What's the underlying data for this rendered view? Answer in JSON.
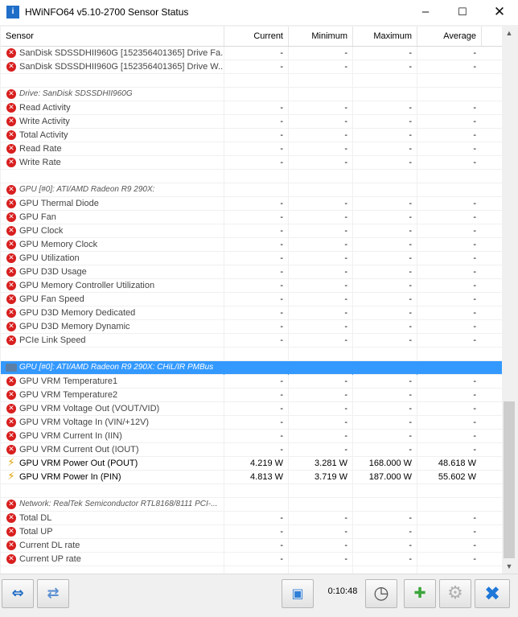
{
  "window": {
    "title": "HWiNFO64 v5.10-2700 Sensor Status",
    "icon_text": "i"
  },
  "columns": {
    "sensor": "Sensor",
    "current": "Current",
    "minimum": "Minimum",
    "maximum": "Maximum",
    "average": "Average"
  },
  "rows": [
    {
      "type": "item",
      "icon": "error",
      "label": "SanDisk SDSSDHII960G [152356401365] Drive Fa...",
      "current": "-",
      "min": "-",
      "max": "-",
      "avg": "-"
    },
    {
      "type": "item",
      "icon": "error",
      "label": "SanDisk SDSSDHII960G [152356401365] Drive W...",
      "current": "-",
      "min": "-",
      "max": "-",
      "avg": "-"
    },
    {
      "type": "blank"
    },
    {
      "type": "group",
      "icon": "error",
      "label": "Drive: SanDisk SDSSDHII960G"
    },
    {
      "type": "item",
      "icon": "error",
      "label": "Read Activity",
      "current": "-",
      "min": "-",
      "max": "-",
      "avg": "-"
    },
    {
      "type": "item",
      "icon": "error",
      "label": "Write Activity",
      "current": "-",
      "min": "-",
      "max": "-",
      "avg": "-"
    },
    {
      "type": "item",
      "icon": "error",
      "label": "Total Activity",
      "current": "-",
      "min": "-",
      "max": "-",
      "avg": "-"
    },
    {
      "type": "item",
      "icon": "error",
      "label": "Read Rate",
      "current": "-",
      "min": "-",
      "max": "-",
      "avg": "-"
    },
    {
      "type": "item",
      "icon": "error",
      "label": "Write Rate",
      "current": "-",
      "min": "-",
      "max": "-",
      "avg": "-"
    },
    {
      "type": "blank"
    },
    {
      "type": "group",
      "icon": "error",
      "label": "GPU [#0]: ATI/AMD Radeon R9 290X:"
    },
    {
      "type": "item",
      "icon": "error",
      "label": "GPU Thermal Diode",
      "current": "-",
      "min": "-",
      "max": "-",
      "avg": "-"
    },
    {
      "type": "item",
      "icon": "error",
      "label": "GPU Fan",
      "current": "-",
      "min": "-",
      "max": "-",
      "avg": "-"
    },
    {
      "type": "item",
      "icon": "error",
      "label": "GPU Clock",
      "current": "-",
      "min": "-",
      "max": "-",
      "avg": "-"
    },
    {
      "type": "item",
      "icon": "error",
      "label": "GPU Memory Clock",
      "current": "-",
      "min": "-",
      "max": "-",
      "avg": "-"
    },
    {
      "type": "item",
      "icon": "error",
      "label": "GPU Utilization",
      "current": "-",
      "min": "-",
      "max": "-",
      "avg": "-"
    },
    {
      "type": "item",
      "icon": "error",
      "label": "GPU D3D Usage",
      "current": "-",
      "min": "-",
      "max": "-",
      "avg": "-"
    },
    {
      "type": "item",
      "icon": "error",
      "label": "GPU Memory Controller Utilization",
      "current": "-",
      "min": "-",
      "max": "-",
      "avg": "-"
    },
    {
      "type": "item",
      "icon": "error",
      "label": "GPU Fan Speed",
      "current": "-",
      "min": "-",
      "max": "-",
      "avg": "-"
    },
    {
      "type": "item",
      "icon": "error",
      "label": "GPU D3D Memory Dedicated",
      "current": "-",
      "min": "-",
      "max": "-",
      "avg": "-"
    },
    {
      "type": "item",
      "icon": "error",
      "label": "GPU D3D Memory Dynamic",
      "current": "-",
      "min": "-",
      "max": "-",
      "avg": "-"
    },
    {
      "type": "item",
      "icon": "error",
      "label": "PCIe Link Speed",
      "current": "-",
      "min": "-",
      "max": "-",
      "avg": "-"
    },
    {
      "type": "blank"
    },
    {
      "type": "group",
      "icon": "gpu",
      "selected": true,
      "label": "GPU [#0]: ATI/AMD Radeon R9 290X: CHiL/IR PMBus"
    },
    {
      "type": "item",
      "icon": "error",
      "label": "GPU VRM Temperature1",
      "current": "-",
      "min": "-",
      "max": "-",
      "avg": "-"
    },
    {
      "type": "item",
      "icon": "error",
      "label": "GPU VRM Temperature2",
      "current": "-",
      "min": "-",
      "max": "-",
      "avg": "-"
    },
    {
      "type": "item",
      "icon": "error",
      "label": "GPU VRM Voltage Out (VOUT/VID)",
      "current": "-",
      "min": "-",
      "max": "-",
      "avg": "-"
    },
    {
      "type": "item",
      "icon": "error",
      "label": "GPU VRM Voltage In (VIN/+12V)",
      "current": "-",
      "min": "-",
      "max": "-",
      "avg": "-"
    },
    {
      "type": "item",
      "icon": "error",
      "label": "GPU VRM Current In (IIN)",
      "current": "-",
      "min": "-",
      "max": "-",
      "avg": "-"
    },
    {
      "type": "item",
      "icon": "error",
      "label": "GPU VRM Current Out (IOUT)",
      "current": "-",
      "min": "-",
      "max": "-",
      "avg": "-"
    },
    {
      "type": "item",
      "icon": "bolt",
      "label": "GPU VRM Power Out (POUT)",
      "current": "4.219 W",
      "min": "3.281 W",
      "max": "168.000 W",
      "avg": "48.618 W"
    },
    {
      "type": "item",
      "icon": "bolt",
      "label": "GPU VRM Power In (PIN)",
      "current": "4.813 W",
      "min": "3.719 W",
      "max": "187.000 W",
      "avg": "55.602 W"
    },
    {
      "type": "blank"
    },
    {
      "type": "group",
      "icon": "error",
      "label": "Network: RealTek Semiconductor RTL8168/8111 PCI-..."
    },
    {
      "type": "item",
      "icon": "error",
      "label": "Total DL",
      "current": "-",
      "min": "-",
      "max": "-",
      "avg": "-"
    },
    {
      "type": "item",
      "icon": "error",
      "label": "Total UP",
      "current": "-",
      "min": "-",
      "max": "-",
      "avg": "-"
    },
    {
      "type": "item",
      "icon": "error",
      "label": "Current DL rate",
      "current": "-",
      "min": "-",
      "max": "-",
      "avg": "-"
    },
    {
      "type": "item",
      "icon": "error",
      "label": "Current UP rate",
      "current": "-",
      "min": "-",
      "max": "-",
      "avg": "-"
    },
    {
      "type": "blank"
    }
  ],
  "toolbar": {
    "timer": "0:10:48"
  },
  "colors": {
    "selection": "#3399ff",
    "error_icon": "#d81e1e",
    "bolt_icon": "#e0a000"
  }
}
